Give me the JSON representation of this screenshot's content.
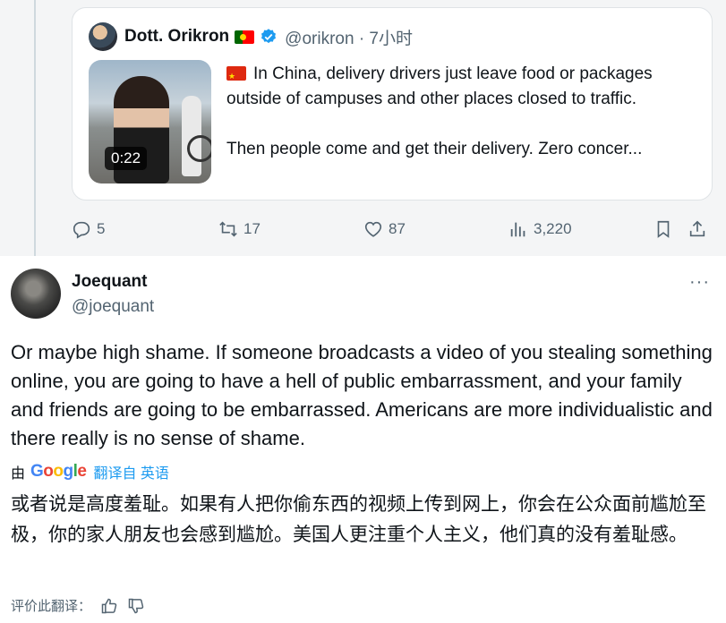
{
  "quoted_tweet": {
    "display_name": "Dott. Orikron",
    "handle_time": "@orikron · 7小时",
    "video_duration": "0:22",
    "text_line1": "In China, delivery drivers just leave food or packages outside of campuses and other places closed to traffic.",
    "text_line2": "Then people come and get their delivery. Zero concer..."
  },
  "actions": {
    "replies": "5",
    "retweets": "17",
    "likes": "87",
    "views": "3,220"
  },
  "reply": {
    "display_name": "Joequant",
    "handle": "@joequant",
    "more": "···",
    "body": "Or maybe high shame.  If someone broadcasts a video of you stealing something online, you are going to have a hell of public embarrassment, and your family and friends are going to be embarrassed.  Americans are more individualistic and there really is no sense of shame.",
    "translated_by": "由",
    "google_letters": [
      "G",
      "o",
      "o",
      "g",
      "l",
      "e"
    ],
    "translate_link": "翻译自 英语",
    "translation": "或者说是高度羞耻。如果有人把你偷东西的视频上传到网上，你会在公众面前尴尬至极，你的家人朋友也会感到尴尬。美国人更注重个人主义，他们真的没有羞耻感。",
    "rate_label": "评价此翻译："
  },
  "colors": {
    "accent": "#1d9bf0",
    "secondary_text": "#536471",
    "thread_bg": "#f4f5f6"
  },
  "icons": [
    "reply-icon",
    "retweet-icon",
    "like-icon",
    "views-icon",
    "bookmark-icon",
    "share-icon",
    "thumbs-up-icon",
    "thumbs-down-icon",
    "verified-icon"
  ]
}
